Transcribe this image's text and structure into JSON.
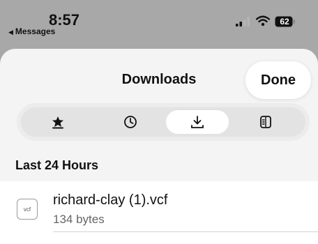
{
  "status_bar": {
    "time": "8:57",
    "back_app": "Messages",
    "battery": "62"
  },
  "sheet": {
    "title": "Downloads",
    "done_label": "Done"
  },
  "segments": [
    {
      "icon": "bookmark-star-icon",
      "active": false
    },
    {
      "icon": "history-clock-icon",
      "active": false
    },
    {
      "icon": "download-icon",
      "active": true
    },
    {
      "icon": "reading-list-icon",
      "active": false
    }
  ],
  "section": {
    "header": "Last 24 Hours"
  },
  "downloads": [
    {
      "icon_label": "vcf",
      "name": "richard-clay (1).vcf",
      "size": "134 bytes"
    }
  ],
  "colors": {
    "background_dim": "#a8a8a8",
    "sheet": "#f4f4f4",
    "segment_track": "#e3e3e3",
    "active_segment": "#ffffff"
  }
}
